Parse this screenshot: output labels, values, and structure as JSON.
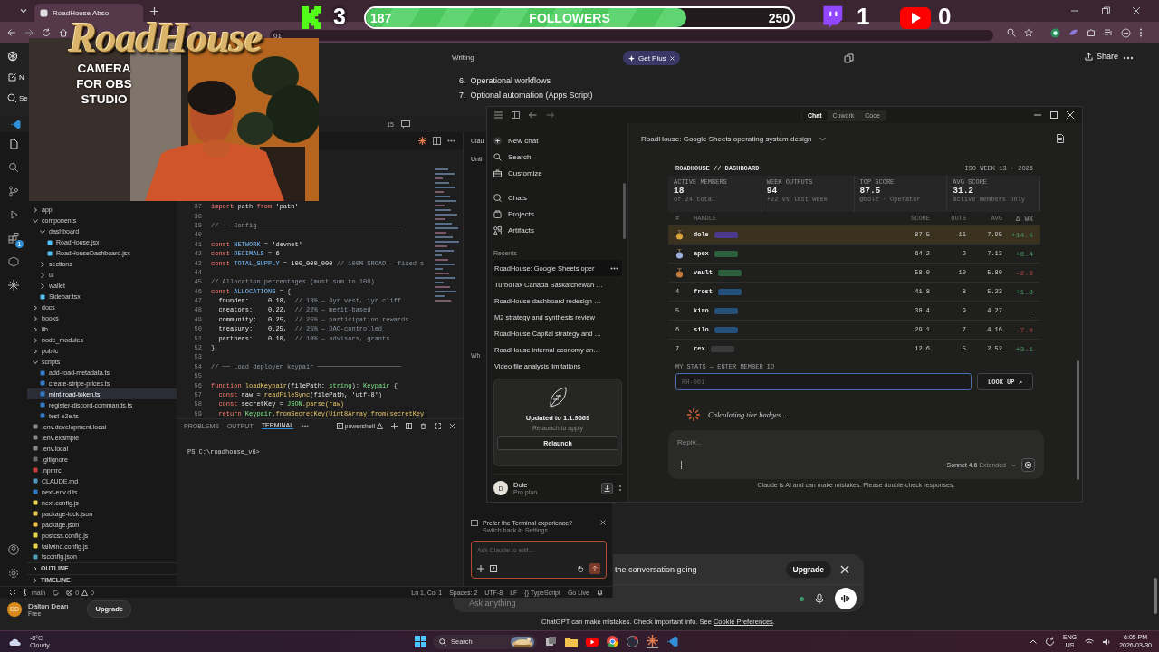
{
  "browser": {
    "tab_title": "RoadHouse Abso",
    "address_text": "01"
  },
  "overlay": {
    "logo": "RoadHouse",
    "camera_caption": "CAMERA FOR OBS STUDIO",
    "kick_count": "3",
    "followers": {
      "current": "187",
      "label": "FOLLOWERS",
      "goal": "250",
      "level": 0.75
    },
    "twitch_count": "1",
    "youtube_count": "0"
  },
  "chatgpt": {
    "sidebar_items": [
      "N",
      "Se"
    ],
    "section_label": "Writing",
    "list": [
      {
        "number": "6.",
        "text": "Operational workflows"
      },
      {
        "number": "7.",
        "text": "Optional automation (Apps Script)"
      }
    ],
    "get_plus": "Get Plus",
    "share": "Share",
    "banner_text": "the conversation going",
    "banner_button": "Upgrade",
    "composer_placeholder": "Ask anything",
    "disclaimer": "ChatGPT can make mistakes. Check important info. See",
    "cookie_link": "Cookie Preferences",
    "disclaimer_end": ".",
    "user": {
      "initials": "DD",
      "name": "Dalton Dean",
      "plan": "Free",
      "upgrade": "Upgrade"
    }
  },
  "vscode": {
    "title_badge": "15",
    "activity_badge": "1",
    "explorer": [
      {
        "name": "app",
        "kind": "folder",
        "expanded": false,
        "selected": false
      },
      {
        "name": "components",
        "kind": "folder",
        "expanded": true,
        "selected": false,
        "children": [
          {
            "name": "dashboard",
            "kind": "folder",
            "expanded": true,
            "selected": false,
            "children": [
              {
                "name": "RoadHouse.jsx",
                "kind": "jsx",
                "selected": false
              },
              {
                "name": "RoadHouseDashboard.jsx",
                "kind": "jsx",
                "selected": false
              }
            ]
          },
          {
            "name": "sections",
            "kind": "folder",
            "expanded": false,
            "selected": false
          },
          {
            "name": "ui",
            "kind": "folder",
            "expanded": false,
            "selected": false
          },
          {
            "name": "wallet",
            "kind": "folder",
            "expanded": false,
            "selected": false
          },
          {
            "name": "Sidebar.tsx",
            "kind": "jsx",
            "selected": false
          }
        ]
      },
      {
        "name": "docs",
        "kind": "folder",
        "expanded": false,
        "selected": false
      },
      {
        "name": "hooks",
        "kind": "folder",
        "expanded": false,
        "selected": false
      },
      {
        "name": "lib",
        "kind": "folder",
        "expanded": false,
        "selected": false
      },
      {
        "name": "node_modules",
        "kind": "folder",
        "expanded": false,
        "selected": false
      },
      {
        "name": "public",
        "kind": "folder",
        "expanded": false,
        "selected": false
      },
      {
        "name": "scripts",
        "kind": "folder",
        "expanded": true,
        "selected": false,
        "children": [
          {
            "name": "add-road-metadata.ts",
            "kind": "ts",
            "selected": false
          },
          {
            "name": "create-stripe-prices.ts",
            "kind": "ts",
            "selected": false
          },
          {
            "name": "mint-road-token.ts",
            "kind": "ts",
            "selected": true
          },
          {
            "name": "register-discord-commands.ts",
            "kind": "ts",
            "selected": false
          },
          {
            "name": "test-e2e.ts",
            "kind": "ts",
            "selected": false
          }
        ]
      },
      {
        "name": ".env.development.local",
        "kind": "env",
        "selected": false
      },
      {
        "name": ".env.example",
        "kind": "env",
        "selected": false
      },
      {
        "name": ".env.local",
        "kind": "env",
        "selected": false
      },
      {
        "name": ".gitignore",
        "kind": "git",
        "selected": false
      },
      {
        "name": ".npmrc",
        "kind": "npm",
        "selected": false
      },
      {
        "name": "CLAUDE.md",
        "kind": "md",
        "selected": false
      },
      {
        "name": "next-env.d.ts",
        "kind": "ts",
        "selected": false
      },
      {
        "name": "next.config.js",
        "kind": "js",
        "selected": false
      },
      {
        "name": "package-lock.json",
        "kind": "json",
        "selected": false
      },
      {
        "name": "package.json",
        "kind": "json",
        "selected": false
      },
      {
        "name": "postcss.config.js",
        "kind": "js",
        "selected": false
      },
      {
        "name": "tailwind.config.js",
        "kind": "js",
        "selected": false
      },
      {
        "name": "tsconfig.json",
        "kind": "cfg",
        "selected": false
      }
    ],
    "sections": [
      "OUTLINE",
      "TIMELINE"
    ],
    "code": [
      {
        "number": "37",
        "parts": [
          {
            "text": "import",
            "kind": "kw"
          },
          {
            "text": " path ",
            "kind": "plain"
          },
          {
            "text": "from",
            "kind": "kw"
          },
          {
            "text": " 'path'",
            "kind": "str"
          }
        ]
      },
      {
        "number": "38"
      },
      {
        "number": "39",
        "parts": [
          {
            "text": "// ── Config ─────────────────────────────────────",
            "kind": "comment"
          }
        ]
      },
      {
        "number": "40"
      },
      {
        "number": "41",
        "parts": [
          {
            "text": "const",
            "kind": "kw"
          },
          {
            "text": " NETWORK",
            "kind": "id"
          },
          {
            "text": " = ",
            "kind": "plain"
          },
          {
            "text": "'devnet'",
            "kind": "str"
          }
        ]
      },
      {
        "number": "42",
        "parts": [
          {
            "text": "const",
            "kind": "kw"
          },
          {
            "text": " DECIMALS",
            "kind": "id"
          },
          {
            "text": " = ",
            "kind": "plain"
          },
          {
            "text": "6",
            "kind": "num"
          }
        ]
      },
      {
        "number": "43",
        "parts": [
          {
            "text": "const",
            "kind": "kw"
          },
          {
            "text": " TOTAL_SUPPLY",
            "kind": "id"
          },
          {
            "text": " = ",
            "kind": "plain"
          },
          {
            "text": "100_000_000",
            "kind": "num"
          },
          {
            "text": " // 100M $ROAD — fixed s",
            "kind": "comment"
          }
        ]
      },
      {
        "number": "44"
      },
      {
        "number": "45",
        "parts": [
          {
            "text": "// Allocation percentages (must sum to 100)",
            "kind": "comment"
          }
        ]
      },
      {
        "number": "46",
        "parts": [
          {
            "text": "const",
            "kind": "kw"
          },
          {
            "text": " ALLOCATIONS",
            "kind": "id"
          },
          {
            "text": " = {",
            "kind": "plain"
          }
        ]
      },
      {
        "number": "47",
        "parts": [
          {
            "text": "  founder:",
            "kind": "prop"
          },
          {
            "text": "     0.18,",
            "kind": "num"
          },
          {
            "text": "  // 18% — 4yr vest, 1yr cliff",
            "kind": "comment"
          }
        ]
      },
      {
        "number": "48",
        "parts": [
          {
            "text": "  creators:",
            "kind": "prop"
          },
          {
            "text": "    0.22,",
            "kind": "num"
          },
          {
            "text": "  // 22% — merit-based",
            "kind": "comment"
          }
        ]
      },
      {
        "number": "49",
        "parts": [
          {
            "text": "  community:",
            "kind": "prop"
          },
          {
            "text": "   0.25,",
            "kind": "num"
          },
          {
            "text": "  // 25% — participation rewards",
            "kind": "comment"
          }
        ]
      },
      {
        "number": "50",
        "parts": [
          {
            "text": "  treasury:",
            "kind": "prop"
          },
          {
            "text": "    0.25,",
            "kind": "num"
          },
          {
            "text": "  // 25% — DAO-controlled",
            "kind": "comment"
          }
        ]
      },
      {
        "number": "51",
        "parts": [
          {
            "text": "  partners:",
            "kind": "prop"
          },
          {
            "text": "    0.10,",
            "kind": "num"
          },
          {
            "text": "  // 10% — advisors, grants",
            "kind": "comment"
          }
        ]
      },
      {
        "number": "52",
        "parts": [
          {
            "text": "}",
            "kind": "plain"
          }
        ]
      },
      {
        "number": "53"
      },
      {
        "number": "54",
        "parts": [
          {
            "text": "// ── Load deployer keypair ──────────────────────",
            "kind": "comment"
          }
        ]
      },
      {
        "number": "55"
      },
      {
        "number": "56",
        "parts": [
          {
            "text": "function",
            "kind": "kw"
          },
          {
            "text": " loadKeypair",
            "kind": "fn"
          },
          {
            "text": "(filePath: ",
            "kind": "prop"
          },
          {
            "text": "string",
            "kind": "type"
          },
          {
            "text": "): ",
            "kind": "plain"
          },
          {
            "text": "Keypair",
            "kind": "type"
          },
          {
            "text": " {",
            "kind": "plain"
          }
        ]
      },
      {
        "number": "57",
        "parts": [
          {
            "text": "  const",
            "kind": "kw"
          },
          {
            "text": " raw = ",
            "kind": "prop"
          },
          {
            "text": "readFileSync",
            "kind": "fn"
          },
          {
            "text": "(filePath, ",
            "kind": "prop"
          },
          {
            "text": "'utf-8'",
            "kind": "str"
          },
          {
            "text": ")",
            "kind": "plain"
          }
        ]
      },
      {
        "number": "58",
        "parts": [
          {
            "text": "  const",
            "kind": "kw"
          },
          {
            "text": " secretKey = ",
            "kind": "prop"
          },
          {
            "text": "JSON",
            "kind": "type"
          },
          {
            "text": ".parse(raw)",
            "kind": "fn"
          }
        ]
      },
      {
        "number": "59",
        "parts": [
          {
            "text": "  return",
            "kind": "kw"
          },
          {
            "text": " Keypair",
            "kind": "type"
          },
          {
            "text": ".fromSecretKey(Uint8Array.from(secretKey",
            "kind": "fn"
          }
        ]
      }
    ],
    "panel_tabs": [
      {
        "label": "PROBLEMS",
        "selected": false
      },
      {
        "label": "OUTPUT",
        "selected": false
      },
      {
        "label": "TERMINAL",
        "selected": true
      }
    ],
    "shell": "powershell",
    "prompt": "PS C:\\roadhouse_v6>",
    "status_left": {
      "branch": "main",
      "errors": "0",
      "warnings": "0"
    },
    "status_right": [
      "Ln 1, Col 1",
      "Spaces: 2",
      "UTF-8",
      "LF",
      "{} TypeScript",
      "Go Live"
    ],
    "side_tab": "Clau",
    "side_title": "Unti",
    "side_fragment": "Wh",
    "claude_panel": {
      "notice": "Prefer the Terminal experience?",
      "notice_link": "Switch back in Settings.",
      "placeholder": "Ask Claude to edit..."
    }
  },
  "claude": {
    "tabs": [
      {
        "label": "Chat",
        "selected": true
      },
      {
        "label": "Cowork",
        "selected": false
      },
      {
        "label": "Code",
        "selected": false
      }
    ],
    "nav": [
      "New chat",
      "Search",
      "Customize",
      "Chats",
      "Projects",
      "Artifacts"
    ],
    "recents_label": "Recents",
    "recents": [
      {
        "title": "RoadHouse: Google Sheets oper",
        "selected": true
      },
      {
        "title": "TurboTax Canada Saskatchewan …",
        "selected": false
      },
      {
        "title": "RoadHouse dashboard redesign …",
        "selected": false
      },
      {
        "title": "M2 strategy and synthesis review",
        "selected": false
      },
      {
        "title": "RoadHouse Capital strategy and …",
        "selected": false
      },
      {
        "title": "RoadHouse internal economy an…",
        "selected": false
      },
      {
        "title": "Video file analysis limitations",
        "selected": false
      }
    ],
    "update": {
      "title": "Updated to 1.1.9669",
      "subtitle": "Relaunch to apply",
      "button": "Relaunch"
    },
    "user": {
      "initial": "D",
      "name": "Dole",
      "plan": "Pro plan"
    },
    "chat_title": "RoadHouse: Google Sheets operating system design",
    "dashboard": {
      "title": "ROADHOUSE // DASHBOARD",
      "week": "ISO WEEK 13 · 2026",
      "stats": [
        {
          "label": "ACTIVE MEMBERS",
          "value": "18",
          "note": "of 24 total"
        },
        {
          "label": "WEEK OUTPUTS",
          "value": "94",
          "note": "+22 vs last week"
        },
        {
          "label": "TOP SCORE",
          "value": "87.5",
          "note": "@dole · Operator"
        },
        {
          "label": "AVG SCORE",
          "value": "31.2",
          "note": "active members only"
        }
      ],
      "columns": [
        "#",
        "HANDLE",
        "SCORE",
        "OUTS",
        "AVG",
        "Δ WK"
      ],
      "rows": [
        {
          "kind": "medal",
          "handle": "dole",
          "tag": {
            "color": "#4b3a8c"
          },
          "score": "87.5",
          "outs": "11",
          "avg": "7.95",
          "delta": {
            "text": "+14.6",
            "color": "#3f7a4f"
          },
          "highlighted": true
        },
        {
          "kind": "medal",
          "handle": "apex",
          "tag": {
            "color": "#2e5f3c"
          },
          "score": "64.2",
          "outs": "9",
          "avg": "7.13",
          "delta": {
            "text": "+8.4",
            "color": "#3f7a4f"
          },
          "highlighted": false
        },
        {
          "kind": "medal",
          "handle": "vault",
          "tag": {
            "color": "#2e5f3c"
          },
          "score": "58.0",
          "outs": "10",
          "avg": "5.80",
          "delta": {
            "text": "-2.3",
            "color": "#8a3a3a"
          },
          "highlighted": false
        },
        {
          "kind": "number",
          "rank": "4",
          "handle": "frost",
          "tag": {
            "color": "#24507a"
          },
          "score": "41.8",
          "outs": "8",
          "avg": "5.23",
          "delta": {
            "text": "+1.8",
            "color": "#3f7a4f"
          },
          "highlighted": false
        },
        {
          "kind": "number",
          "rank": "5",
          "handle": "kiro",
          "tag": {
            "color": "#24507a"
          },
          "score": "38.4",
          "outs": "9",
          "avg": "4.27",
          "delta": {
            "text": "—"
          },
          "highlighted": false
        },
        {
          "kind": "number",
          "rank": "6",
          "handle": "silo",
          "tag": {
            "color": "#24507a"
          },
          "score": "29.1",
          "outs": "7",
          "avg": "4.16",
          "delta": {
            "text": "-7.0",
            "color": "#8a3a3a"
          },
          "highlighted": false
        },
        {
          "kind": "number",
          "rank": "7",
          "handle": "rex",
          "tag": {
            "color": "#3a3a3a"
          },
          "score": "12.6",
          "outs": "5",
          "avg": "2.52",
          "delta": {
            "text": "+3.1",
            "color": "#3f7a4f"
          },
          "highlighted": false
        }
      ],
      "member_label": "MY STATS — ENTER MEMBER ID",
      "member_placeholder": "RH-001",
      "lookup": "LOOK UP ↗"
    },
    "status": "Calculating tier badges...",
    "composer": {
      "placeholder": "Reply...",
      "model": "Sonnet 4.6",
      "mode": "Extended"
    },
    "disclaimer": "Claude is AI and can make mistakes. Please double-check responses."
  },
  "taskbar": {
    "temp": "-8°C",
    "condition": "Cloudy",
    "search": "Search",
    "lang": "ENG",
    "region": "US",
    "time": "6:05 PM",
    "date": "2026-03-30"
  }
}
